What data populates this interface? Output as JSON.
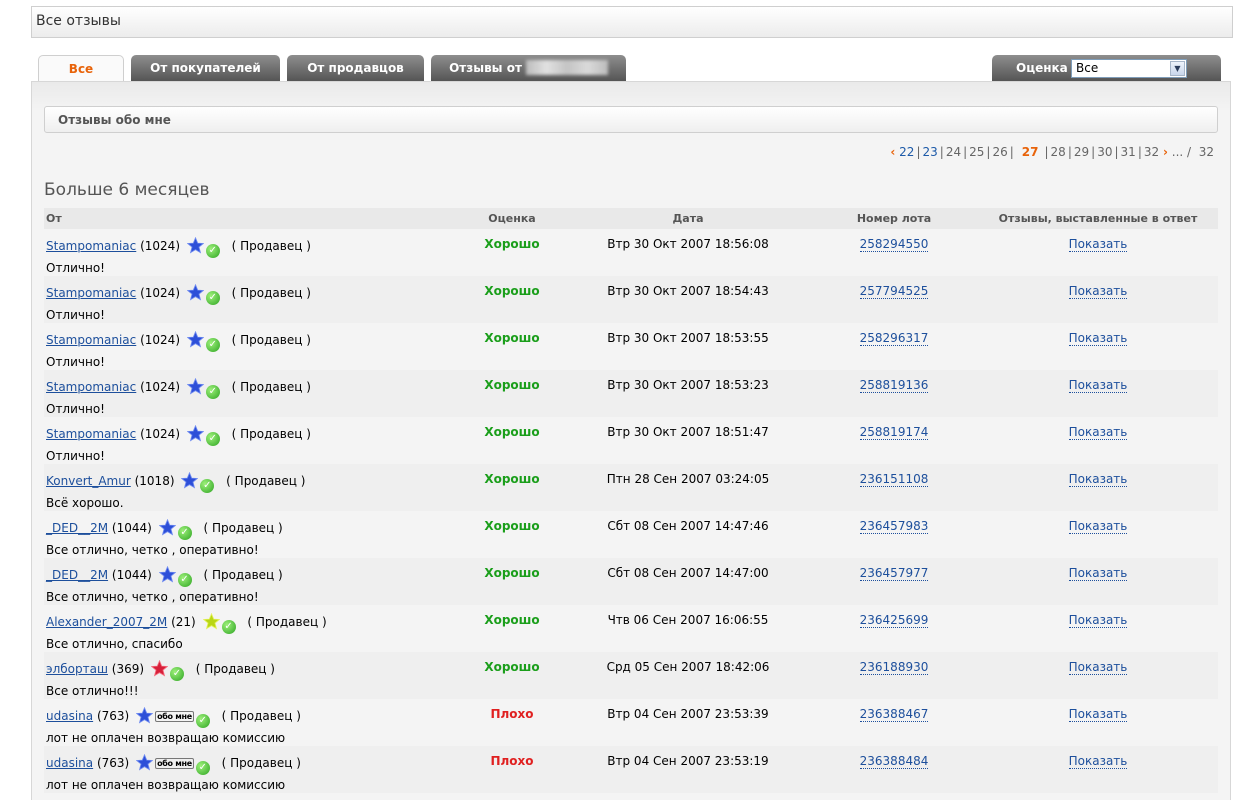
{
  "title": "Все отзывы",
  "tabs": [
    {
      "label": "Все",
      "active": true
    },
    {
      "label": "От покупателей"
    },
    {
      "label": "От продавцов"
    },
    {
      "label": "Отзывы от"
    }
  ],
  "grade_filter": {
    "label": "Оценка",
    "value": "Все"
  },
  "subheader": "Отзывы обо мне",
  "pager": {
    "prev": [
      "22",
      "23",
      "24",
      "25",
      "26"
    ],
    "current": "27",
    "next": [
      "28",
      "29",
      "30",
      "31",
      "32"
    ],
    "ellipsis": "...",
    "slash": "/",
    "total": "32"
  },
  "section_title": "Больше 6 месяцев",
  "columns": {
    "from": "От",
    "grade": "Оценка",
    "date": "Дата",
    "lot": "Номер лота",
    "response": "Отзывы, выставленные в ответ"
  },
  "colors": {
    "good": "#1a9e1a",
    "bad": "#e02020",
    "accent": "#e8630a",
    "link": "#1d4f9c"
  },
  "rows": [
    {
      "user": "Stampomaniac",
      "score": "(1024)",
      "star": "blue",
      "badge": "",
      "role": "( Продавец )",
      "comment": "Отлично!",
      "grade": "Хорошо",
      "grade_type": "good",
      "date": "Втр 30 Окт 2007 18:56:08",
      "lot": "258294550",
      "show": "Показать"
    },
    {
      "user": "Stampomaniac",
      "score": "(1024)",
      "star": "blue",
      "badge": "",
      "role": "( Продавец )",
      "comment": "Отлично!",
      "grade": "Хорошо",
      "grade_type": "good",
      "date": "Втр 30 Окт 2007 18:54:43",
      "lot": "257794525",
      "show": "Показать"
    },
    {
      "user": "Stampomaniac",
      "score": "(1024)",
      "star": "blue",
      "badge": "",
      "role": "( Продавец )",
      "comment": "Отлично!",
      "grade": "Хорошо",
      "grade_type": "good",
      "date": "Втр 30 Окт 2007 18:53:55",
      "lot": "258296317",
      "show": "Показать"
    },
    {
      "user": "Stampomaniac",
      "score": "(1024)",
      "star": "blue",
      "badge": "",
      "role": "( Продавец )",
      "comment": "Отлично!",
      "grade": "Хорошо",
      "grade_type": "good",
      "date": "Втр 30 Окт 2007 18:53:23",
      "lot": "258819136",
      "show": "Показать"
    },
    {
      "user": "Stampomaniac",
      "score": "(1024)",
      "star": "blue",
      "badge": "",
      "role": "( Продавец )",
      "comment": "Отлично!",
      "grade": "Хорошо",
      "grade_type": "good",
      "date": "Втр 30 Окт 2007 18:51:47",
      "lot": "258819174",
      "show": "Показать"
    },
    {
      "user": "Konvert_Amur",
      "score": "(1018)",
      "star": "blue",
      "badge": "",
      "role": "( Продавец )",
      "comment": "Всё хорошо.",
      "grade": "Хорошо",
      "grade_type": "good",
      "date": "Птн 28 Сен 2007 03:24:05",
      "lot": "236151108",
      "show": "Показать"
    },
    {
      "user": "_DED__2M",
      "score": "(1044)",
      "star": "blue",
      "badge": "",
      "role": "( Продавец )",
      "comment": "Все отлично, четко , оперативно!",
      "grade": "Хорошо",
      "grade_type": "good",
      "date": "Сбт 08 Сен 2007 14:47:46",
      "lot": "236457983",
      "show": "Показать"
    },
    {
      "user": "_DED__2M",
      "score": "(1044)",
      "star": "blue",
      "badge": "",
      "role": "( Продавец )",
      "comment": "Все отлично, четко , оперативно!",
      "grade": "Хорошо",
      "grade_type": "good",
      "date": "Сбт 08 Сен 2007 14:47:00",
      "lot": "236457977",
      "show": "Показать"
    },
    {
      "user": "Alexander_2007_2M",
      "score": "(21)",
      "star": "yellow",
      "badge": "",
      "role": "( Продавец )",
      "comment": "Все отлично, спасибо",
      "grade": "Хорошо",
      "grade_type": "good",
      "date": "Чтв 06 Сен 2007 16:06:55",
      "lot": "236425699",
      "show": "Показать"
    },
    {
      "user": "элборташ",
      "score": "(369)",
      "star": "red",
      "badge": "",
      "role": "( Продавец )",
      "comment": "Все отлично!!!",
      "grade": "Хорошо",
      "grade_type": "good",
      "date": "Срд 05 Сен 2007 18:42:06",
      "lot": "236188930",
      "show": "Показать"
    },
    {
      "user": "udasina",
      "score": "(763)",
      "star": "blue",
      "badge": "обо мне",
      "role": "( Продавец )",
      "comment": "лот не оплачен возвращаю комиссию",
      "grade": "Плохо",
      "grade_type": "bad",
      "date": "Втр 04 Сен 2007 23:53:39",
      "lot": "236388467",
      "show": "Показать"
    },
    {
      "user": "udasina",
      "score": "(763)",
      "star": "blue",
      "badge": "обо мне",
      "role": "( Продавец )",
      "comment": "лот не оплачен возвращаю комиссию",
      "grade": "Плохо",
      "grade_type": "bad",
      "date": "Втр 04 Сен 2007 23:53:19",
      "lot": "236388484",
      "show": "Показать"
    }
  ]
}
